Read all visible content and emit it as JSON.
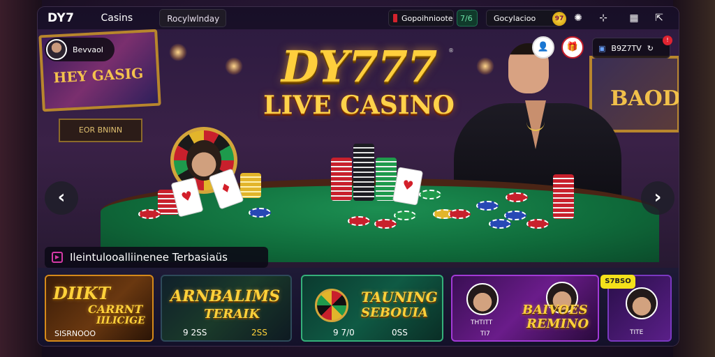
{
  "topbar": {
    "logo": "DY7",
    "nav_link": "Casins",
    "search_text": "Rocylwlnday",
    "pill_a": "Gopoihnioote",
    "pill_b": "7/6",
    "pill_c": "Gocylacioo",
    "pill_c_badge": "97",
    "icons": [
      "spinner-icon",
      "filter-icon",
      "calendar-icon",
      "expand-icon"
    ]
  },
  "user": {
    "name": "Bevvaol"
  },
  "chip_right": {
    "label": "B9Z7TV",
    "badge": "!"
  },
  "hero": {
    "title_line1": "DY777",
    "title_line2": "LIVE CASINO",
    "tm": "®"
  },
  "signs": {
    "left_main": "HEY GASIG",
    "left_sub": "EOR BNINN",
    "right_main": "BAOD"
  },
  "section": {
    "title": "Ileintulooalliinenee Terbasiaüs"
  },
  "games": [
    {
      "title": "DIIKT",
      "title2": "CARRNT",
      "title3": "IILICIGE",
      "sub": "SISRNOOO"
    },
    {
      "title": "ARNBALIMS",
      "title2": "TERAIK",
      "sub": "9 2SS",
      "sub2": "2SS"
    },
    {
      "title": "TAUNING",
      "title2": "SEBOUIA",
      "sub": "9 7/0",
      "sub2": "0SS"
    },
    {
      "title": "BAIVOES",
      "title2": "REMINO",
      "sub": "THTITT",
      "sub2": "TI7"
    },
    {
      "tag": "S7BSO",
      "sub": "TITE"
    }
  ],
  "nav": {
    "prev": "‹",
    "next": "›"
  },
  "colors": {
    "gold": "#ffcf3d",
    "felt": "#1c8f52",
    "accent_pink": "#d43aa6"
  }
}
